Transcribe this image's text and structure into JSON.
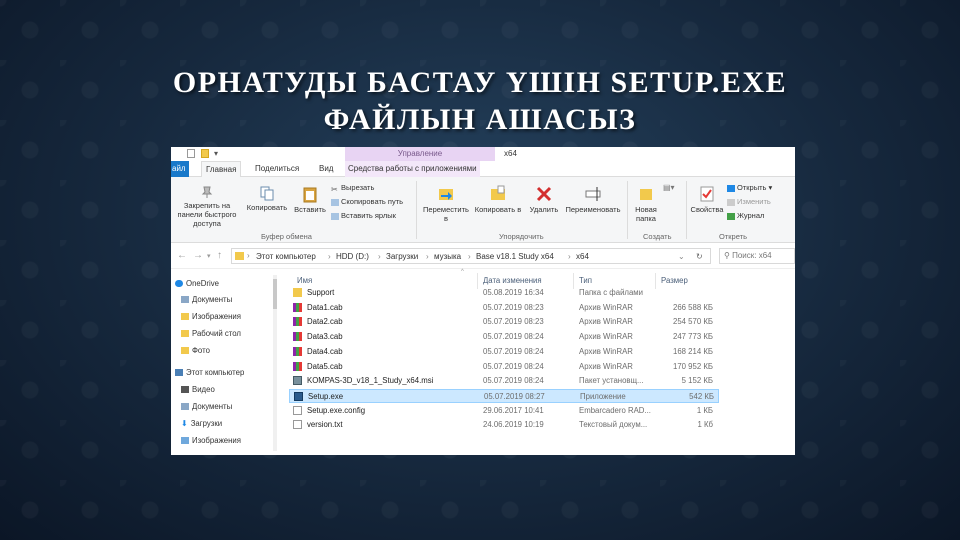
{
  "slide": {
    "title_line1": "ОРНАТУДЫ БАСТАУ ҮШІН SETUP.EXE",
    "title_line2": "ФАЙЛЫН АШАСЫЗ"
  },
  "explorer": {
    "context_group": "Управление",
    "window_title": "x64",
    "tabs": {
      "file": "айл",
      "home": "Главная",
      "share": "Поделиться",
      "view": "Вид",
      "app_tools": "Средства работы с приложениями"
    },
    "ribbon": {
      "pin": "Закрепить на панели быстрого доступа",
      "copy": "Копировать",
      "paste": "Вставить",
      "cut": "Вырезать",
      "copy_path": "Скопировать путь",
      "paste_shortcut": "Вставить ярлык",
      "group_clipboard": "Буфер обмена",
      "move_to": "Переместить в",
      "copy_to": "Копировать в",
      "delete": "Удалить",
      "rename": "Переименовать",
      "group_organize": "Упорядочить",
      "new_folder": "Новая папка",
      "group_create": "Создать",
      "properties": "Свойства",
      "open": "Открыть",
      "edit": "Изменить",
      "history": "Журнал",
      "group_open": "Откреть"
    },
    "address": {
      "crumbs": [
        "Этот компьютер",
        "HDD (D:)",
        "Загрузки",
        "музыка",
        "Base v18.1 Study x64",
        "x64"
      ],
      "search_placeholder": "Поиск: x64"
    },
    "nav": {
      "items": [
        {
          "label": "OneDrive",
          "icon": "cloud-icon"
        },
        {
          "label": "Документы",
          "icon": "folder-icon"
        },
        {
          "label": "Изображения",
          "icon": "folder-icon"
        },
        {
          "label": "Рабочий стол",
          "icon": "folder-icon"
        },
        {
          "label": "Фото",
          "icon": "folder-icon"
        },
        {
          "label": "Этот компьютер",
          "icon": "computer-icon"
        },
        {
          "label": "Видео",
          "icon": "video-icon"
        },
        {
          "label": "Документы",
          "icon": "documents-icon"
        },
        {
          "label": "Загрузки",
          "icon": "download-icon"
        },
        {
          "label": "Изображения",
          "icon": "pictures-icon"
        }
      ]
    },
    "columns": {
      "name": "Имя",
      "date": "Дата изменения",
      "type": "Тип",
      "size": "Размер"
    },
    "files": [
      {
        "name": "Support",
        "date": "05.08.2019 16:34",
        "type": "Папка с файлами",
        "size": "",
        "icon": "folder-icon"
      },
      {
        "name": "Data1.cab",
        "date": "05.07.2019 08:23",
        "type": "Архив WinRAR",
        "size": "266 588 КБ",
        "icon": "winrar-icon"
      },
      {
        "name": "Data2.cab",
        "date": "05.07.2019 08:23",
        "type": "Архив WinRAR",
        "size": "254 570 КБ",
        "icon": "winrar-icon"
      },
      {
        "name": "Data3.cab",
        "date": "05.07.2019 08:24",
        "type": "Архив WinRAR",
        "size": "247 773 КБ",
        "icon": "winrar-icon"
      },
      {
        "name": "Data4.cab",
        "date": "05.07.2019 08:24",
        "type": "Архив WinRAR",
        "size": "168 214 КБ",
        "icon": "winrar-icon"
      },
      {
        "name": "Data5.cab",
        "date": "05.07.2019 08:24",
        "type": "Архив WinRAR",
        "size": "170 952 КБ",
        "icon": "winrar-icon"
      },
      {
        "name": "KOMPAS-3D_v18_1_Study_x64.msi",
        "date": "05.07.2019 08:24",
        "type": "Пакет установщ...",
        "size": "5 152 КБ",
        "icon": "msi-icon"
      },
      {
        "name": "Setup.exe",
        "date": "05.07.2019 08:27",
        "type": "Приложение",
        "size": "542 КБ",
        "icon": "exe-icon",
        "selected": true
      },
      {
        "name": "Setup.exe.config",
        "date": "29.06.2017 10:41",
        "type": "Embarcadero RAD...",
        "size": "1 КБ",
        "icon": "config-icon"
      },
      {
        "name": "version.txt",
        "date": "24.06.2019 10:19",
        "type": "Текстовый докум...",
        "size": "1 Кб",
        "icon": "text-file-icon"
      }
    ]
  }
}
